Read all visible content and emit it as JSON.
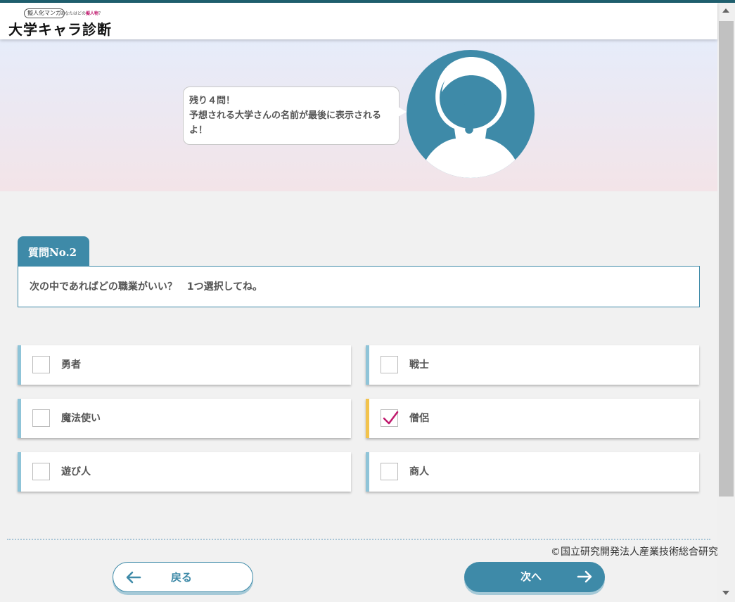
{
  "logo": {
    "sub": "擬人化マンガ",
    "tag_prefix": "あなたはどの",
    "tag_highlight": "擬人物",
    "tag_suffix": "？",
    "main": "大学キャラ診断"
  },
  "hero": {
    "bubble_line1": "残り４問！",
    "bubble_line2": "予想される大学さんの名前が最後に表示されるよ！",
    "avatar_icon": "question-silhouette-icon"
  },
  "question": {
    "tab_label": "質問No.2",
    "text": "次の中であればどの職業がいい？　1つ選択してね。"
  },
  "options": [
    {
      "label": "勇者",
      "checked": false
    },
    {
      "label": "戦士",
      "checked": false
    },
    {
      "label": "魔法使い",
      "checked": false
    },
    {
      "label": "僧侶",
      "checked": true
    },
    {
      "label": "遊び人",
      "checked": false
    },
    {
      "label": "商人",
      "checked": false
    }
  ],
  "footer": {
    "copyright": "©国立研究開発法人産業技術総合研究所"
  },
  "buttons": {
    "back_label": "戻る",
    "next_label": "次へ"
  },
  "colors": {
    "accent": "#3e8aa8",
    "selected_bar": "#f2c34d",
    "check_mark": "#c0196d"
  }
}
